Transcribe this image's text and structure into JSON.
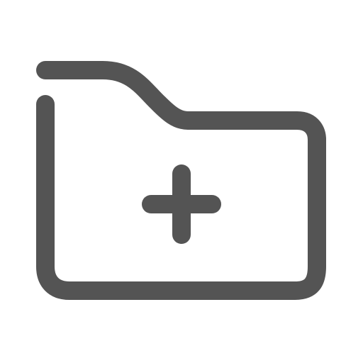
{
  "icon": {
    "name": "folder-add-icon",
    "stroke_color": "#545454",
    "background_color": "#ffffff"
  }
}
